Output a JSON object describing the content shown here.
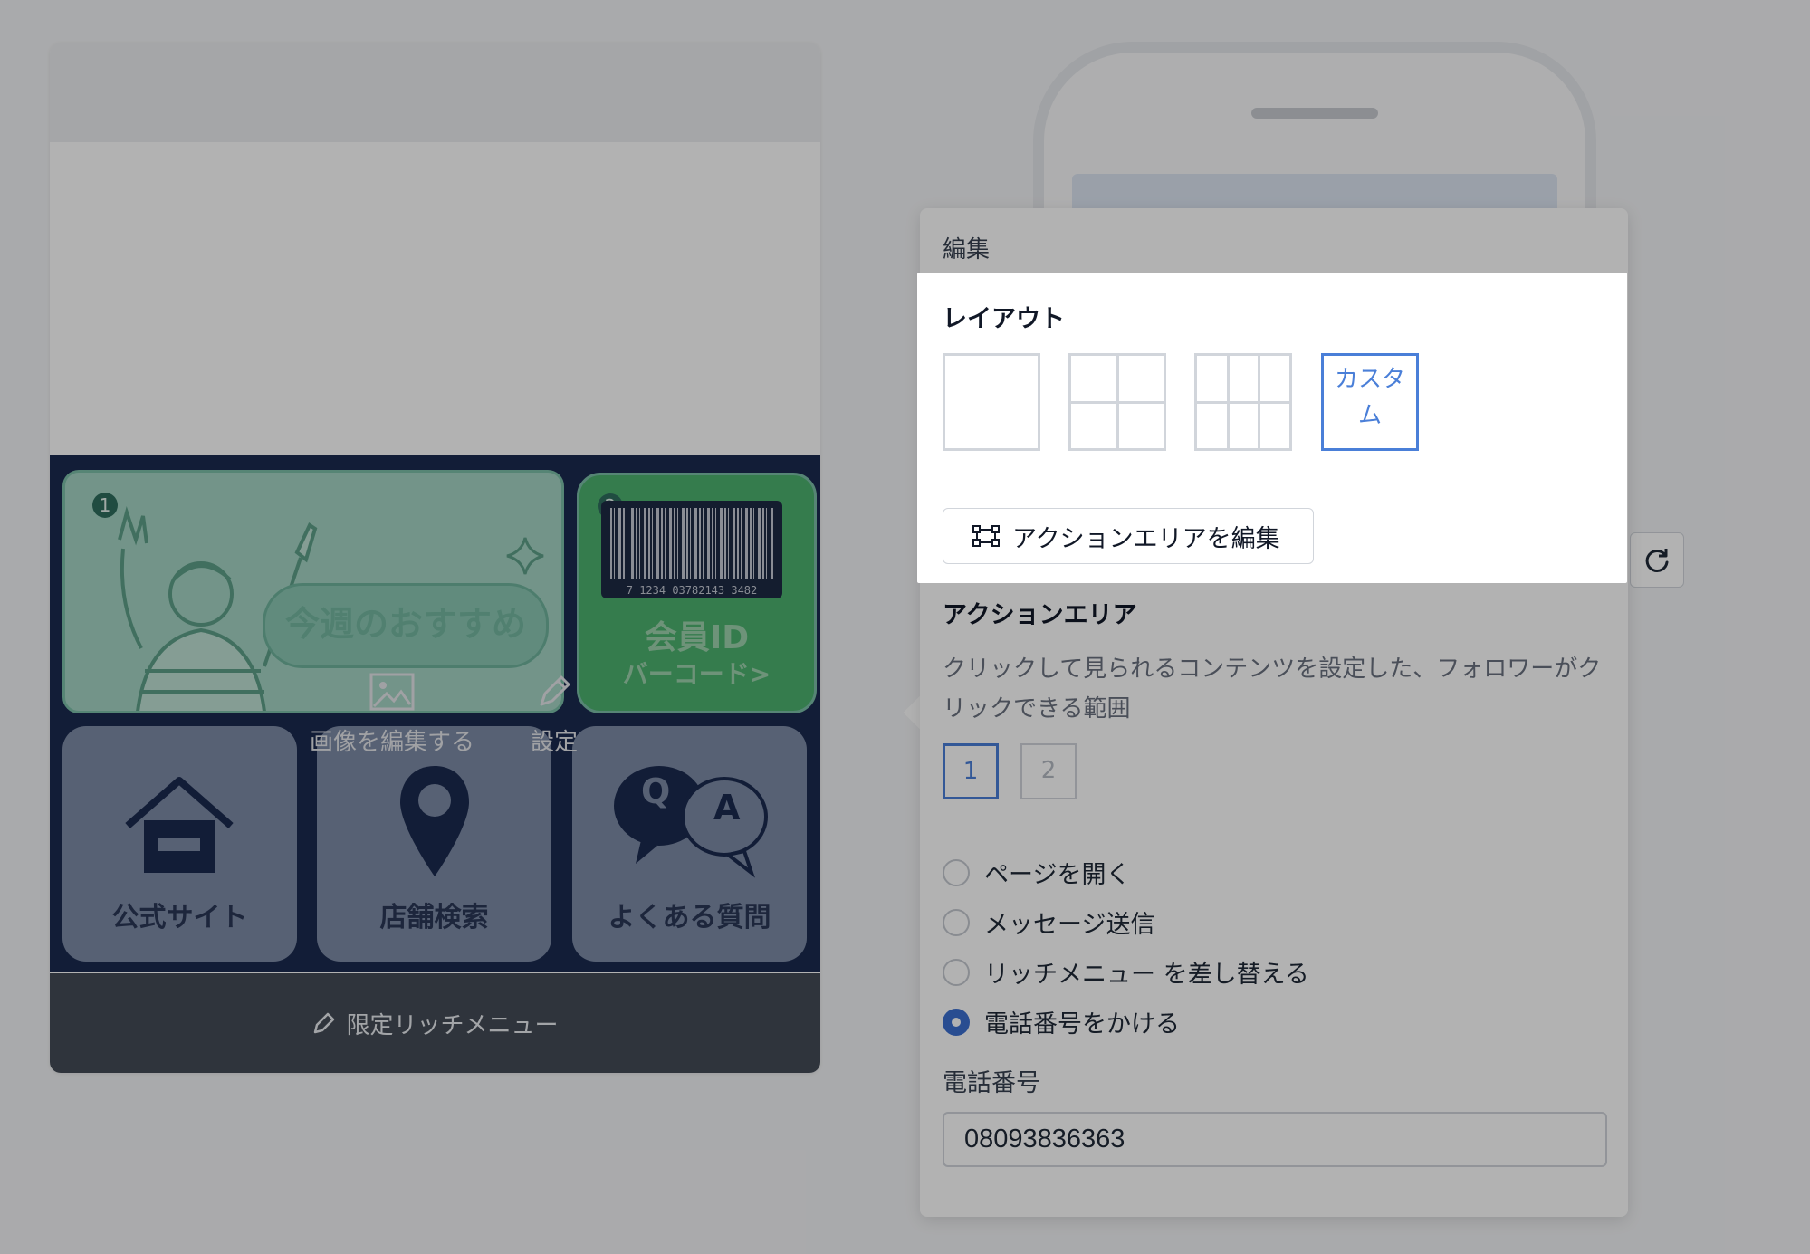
{
  "preview": {
    "tile_1": {
      "number": "1",
      "banner": "今週のおすすめ"
    },
    "tile_2": {
      "number": "2",
      "barcode_number": "7 1234 03782143 3482",
      "line1": "会員ID",
      "line2": "バーコード>"
    },
    "tile_3": {
      "label": "公式サイト",
      "icon": "house-icon"
    },
    "tile_4": {
      "label": "店舗検索",
      "icon": "map-pin-icon"
    },
    "tile_5": {
      "label": "よくある質問",
      "icon": "qa-bubbles-icon",
      "q": "Q",
      "a": "A"
    },
    "edit_image_label": "画像を編集する",
    "settings_label": "設定",
    "footer_label": "限定リッチメニュー"
  },
  "panel": {
    "title": "編集",
    "layout": {
      "title": "レイアウト",
      "custom_label": "カスタム",
      "selected": "custom"
    },
    "edit_action_area_button": "アクションエリアを編集",
    "action_area": {
      "title": "アクションエリア",
      "description": "クリックして見られるコンテンツを設定した、フォロワーがクリックできる範囲",
      "areas": [
        "1",
        "2"
      ],
      "selected_area": "1"
    },
    "actions": {
      "options": [
        "ページを開く",
        "メッセージ送信",
        "リッチメニュー を差し替える",
        "電話番号をかける"
      ],
      "selected_index": 3
    },
    "phone": {
      "label": "電話番号",
      "value": "08093836363"
    }
  },
  "colors": {
    "accent": "#4a7fd8",
    "radio_selected": "#3c6fd0",
    "menu_background": "#1b2a4f",
    "overlay": "rgba(0,0,0,0.30)"
  }
}
